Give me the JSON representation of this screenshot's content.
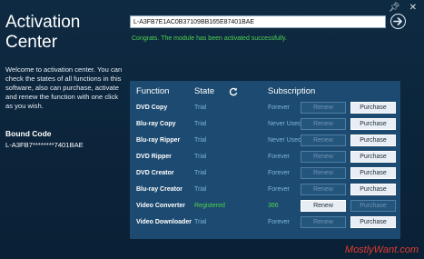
{
  "window": {
    "pin_icon": "pin-icon",
    "close_icon": "close-icon"
  },
  "title": "Activation Center",
  "welcome_text": "Welcome to activation center. You can check the states of all functions in this software, also can purchase, activate and renew the function with one click as you wish.",
  "bound_code": {
    "label": "Bound Code",
    "value": "L-A3FB7********7401BAE"
  },
  "activation": {
    "code": "L-A3FB7E1AC0B37109BB165E87401BAE",
    "status": "Congrats. The module has been activated successfully."
  },
  "table": {
    "headers": {
      "function": "Function",
      "state": "State",
      "subscription": "Subscription"
    },
    "rows": [
      {
        "function": "DVD Copy",
        "state": "Trial",
        "subscription": "Forever",
        "renew": "Renew",
        "purchase": "Purchase",
        "renew_enabled": false,
        "purchase_enabled": true
      },
      {
        "function": "Blu-ray Copy",
        "state": "Trial",
        "subscription": "Never Used",
        "renew": "Renew",
        "purchase": "Purchase",
        "renew_enabled": false,
        "purchase_enabled": true
      },
      {
        "function": "Blu-ray Ripper",
        "state": "Trial",
        "subscription": "Never Used",
        "renew": "Renew",
        "purchase": "Purchase",
        "renew_enabled": false,
        "purchase_enabled": true
      },
      {
        "function": "DVD Ripper",
        "state": "Trial",
        "subscription": "Forever",
        "renew": "Renew",
        "purchase": "Purchase",
        "renew_enabled": false,
        "purchase_enabled": true
      },
      {
        "function": "DVD Creator",
        "state": "Trial",
        "subscription": "Forever",
        "renew": "Renew",
        "purchase": "Purchase",
        "renew_enabled": false,
        "purchase_enabled": true
      },
      {
        "function": "Blu-ray Creator",
        "state": "Trial",
        "subscription": "Forever",
        "renew": "Renew",
        "purchase": "Purchase",
        "renew_enabled": false,
        "purchase_enabled": true
      },
      {
        "function": "Video Converter",
        "state": "Registered",
        "subscription": "366",
        "renew": "Renew",
        "purchase": "Purchase",
        "renew_enabled": true,
        "purchase_enabled": false
      },
      {
        "function": "Video Downloader",
        "state": "Trial",
        "subscription": "Forever",
        "renew": "Renew",
        "purchase": "Purchase",
        "renew_enabled": false,
        "purchase_enabled": true
      }
    ]
  },
  "watermark": "MostlyWant.com",
  "colors": {
    "background": "#0b2236",
    "panel": "#1c4a70",
    "success": "#4fd24f",
    "muted_value": "#7fb4de",
    "watermark": "#e23b2e"
  }
}
